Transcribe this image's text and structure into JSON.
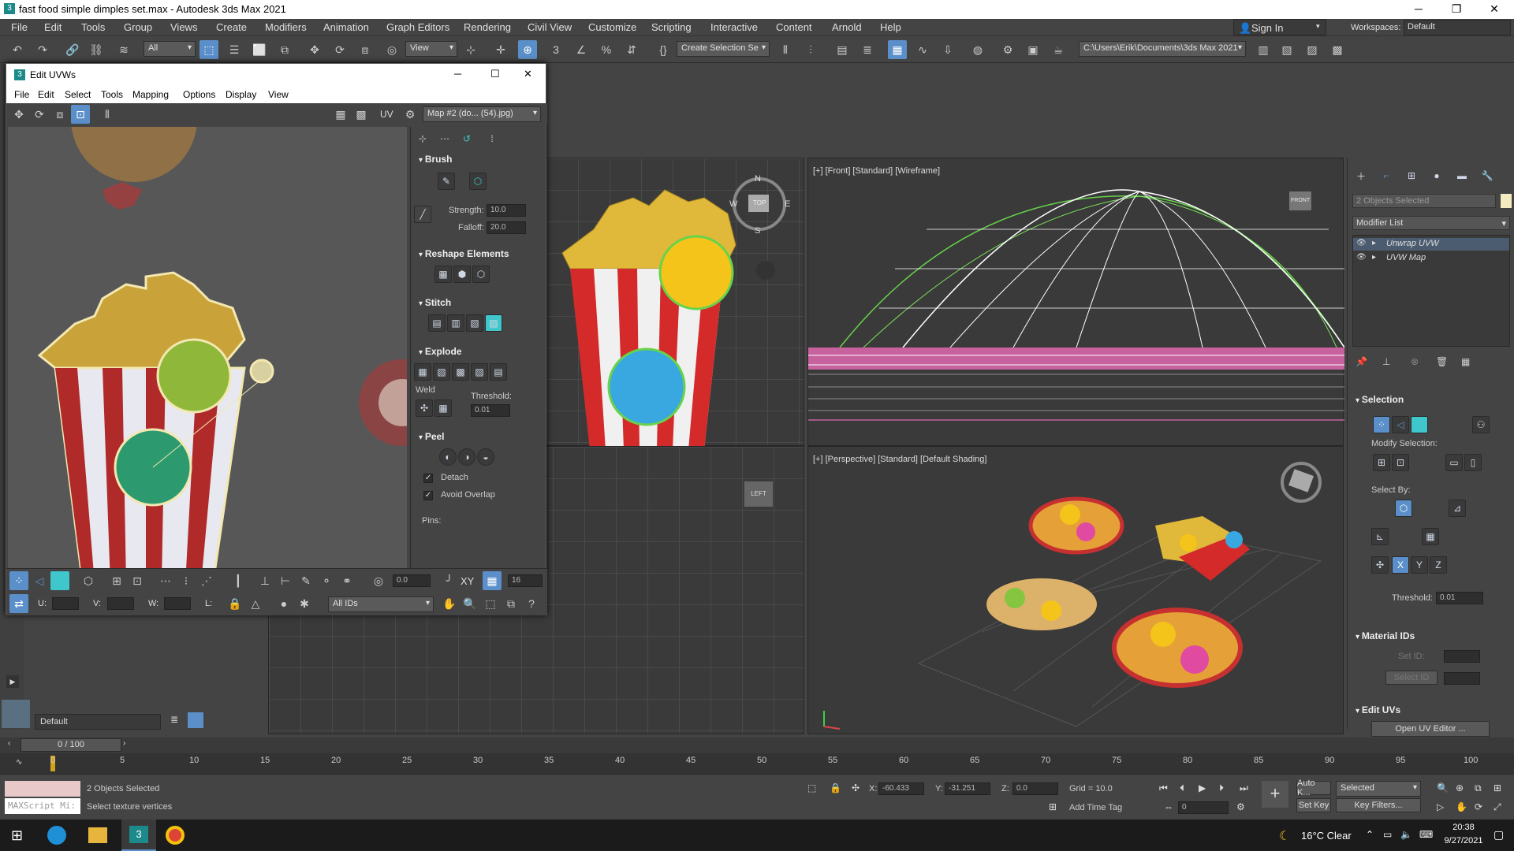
{
  "app": {
    "title": "fast food simple dimples set.max - Autodesk 3ds Max 2021",
    "menus": [
      "File",
      "Edit",
      "Tools",
      "Group",
      "Views",
      "Create",
      "Modifiers",
      "Animation",
      "Graph Editors",
      "Rendering",
      "Civil View",
      "Customize",
      "Scripting",
      "Interactive",
      "Content",
      "Arnold",
      "Help"
    ],
    "sign_in": "Sign In",
    "workspaces_label": "Workspaces:",
    "workspaces_value": "Default"
  },
  "toolbar": {
    "filter_all": "All",
    "ref_coord": "View",
    "named_sel": "Create Selection Se",
    "project_path": "C:\\Users\\Erik\\Documents\\3ds Max 2021"
  },
  "uv_editor": {
    "title": "Edit UVWs",
    "menus": [
      "File",
      "Edit",
      "Select",
      "Tools",
      "Mapping",
      "Options",
      "Display",
      "View"
    ],
    "uv_label": "UV",
    "map_dropdown": "Map #2 (do... (54).jpg)",
    "rollouts": {
      "brush": "Brush",
      "strength_label": "Strength:",
      "strength_value": "10.0",
      "falloff_label": "Falloff:",
      "falloff_value": "20.0",
      "reshape": "Reshape Elements",
      "stitch": "Stitch",
      "explode": "Explode",
      "weld": "Weld",
      "threshold_label": "Threshold:",
      "threshold_value": "0.01",
      "peel": "Peel",
      "detach": "Detach",
      "avoid_overlap": "Avoid Overlap",
      "pins": "Pins:"
    },
    "bottom": {
      "rotate_value": "0.0",
      "xy_label": "XY",
      "grid_value": "16",
      "u_label": "U:",
      "v_label": "V:",
      "w_label": "W:",
      "l_label": "L:",
      "ids_dropdown": "All IDs"
    }
  },
  "viewports": {
    "front_label": "[+] [Front] [Standard] [Wireframe]",
    "persp_label": "[+] [Perspective] [Standard] [Default Shading]",
    "compass": {
      "n": "N",
      "s": "S",
      "e": "E",
      "w": "W"
    },
    "viewcube_top": "TOP",
    "viewcube_front": "FRONT",
    "viewcube_left": "LEFT"
  },
  "command_panel": {
    "objects_selected": "2 Objects Selected",
    "modifier_list": "Modifier List",
    "stack": [
      "Unwrap UVW",
      "UVW Map"
    ],
    "selection": "Selection",
    "modify_selection": "Modify Selection:",
    "select_by": "Select By:",
    "threshold_label": "Threshold:",
    "threshold_value": "0.01",
    "material_ids": "Material IDs",
    "set_id": "Set ID:",
    "select_id": "Select ID",
    "edit_uvs": "Edit UVs",
    "open_uv_editor": "Open UV Editor ..."
  },
  "layer": {
    "value": "Default"
  },
  "timeline": {
    "frame": "0 / 100",
    "ticks": [
      "0",
      "5",
      "10",
      "15",
      "20",
      "25",
      "30",
      "35",
      "40",
      "45",
      "50",
      "55",
      "60",
      "65",
      "70",
      "75",
      "80",
      "85",
      "90",
      "95",
      "100"
    ]
  },
  "status": {
    "maxscript": "MAXScript Mi:",
    "line1": "2 Objects Selected",
    "line2": "Select texture vertices",
    "x_label": "X:",
    "x_value": "-60.433",
    "y_label": "Y:",
    "y_value": "-31.251",
    "z_label": "Z:",
    "z_value": "0.0",
    "grid": "Grid = 10.0",
    "add_time_tag": "Add Time Tag",
    "auto_key": "Auto K...",
    "set_key": "Set Key",
    "selected": "Selected",
    "key_filters": "Key Filters...",
    "frame_value": "0"
  },
  "taskbar": {
    "weather": "16°C  Clear",
    "time": "20:38",
    "date": "9/27/2021"
  },
  "colors": {
    "ui_bg": "#444444",
    "accent_blue": "#5b8fc9",
    "selection_green": "#67d34a",
    "fries_yellow": "#e0b83a",
    "stripe_red": "#d42a2a"
  }
}
